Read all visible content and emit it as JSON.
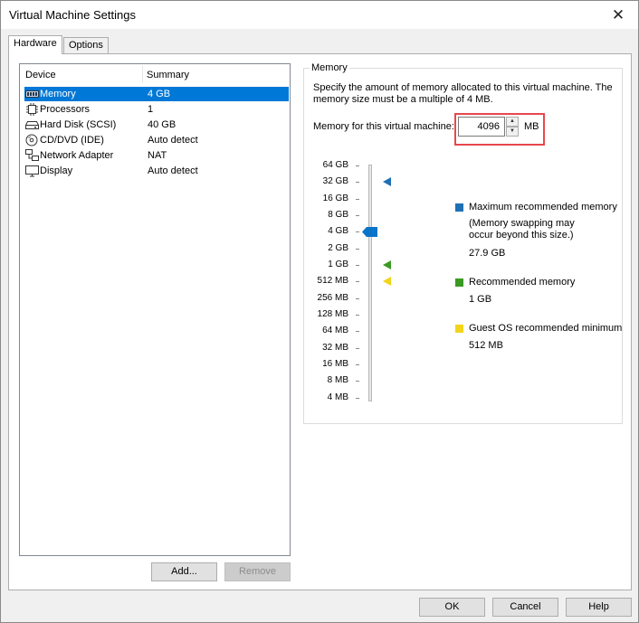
{
  "window": {
    "title": "Virtual Machine Settings",
    "close_glyph": "✕"
  },
  "tabs": [
    {
      "label": "Hardware",
      "active": true
    },
    {
      "label": "Options",
      "active": false
    }
  ],
  "device_list": {
    "columns": [
      "Device",
      "Summary"
    ],
    "rows": [
      {
        "device": "Memory",
        "summary": "4 GB",
        "icon": "memory-icon",
        "selected": true
      },
      {
        "device": "Processors",
        "summary": "1",
        "icon": "processor-icon",
        "selected": false
      },
      {
        "device": "Hard Disk (SCSI)",
        "summary": "40 GB",
        "icon": "hard-disk-icon",
        "selected": false
      },
      {
        "device": "CD/DVD (IDE)",
        "summary": "Auto detect",
        "icon": "cd-dvd-icon",
        "selected": false
      },
      {
        "device": "Network Adapter",
        "summary": "NAT",
        "icon": "network-adapter-icon",
        "selected": false
      },
      {
        "device": "Display",
        "summary": "Auto detect",
        "icon": "display-icon",
        "selected": false
      }
    ]
  },
  "list_buttons": {
    "add": "Add...",
    "remove": "Remove"
  },
  "memory": {
    "group_label": "Memory",
    "description": "Specify the amount of memory allocated to this virtual machine. The memory size must be a multiple of 4 MB.",
    "field_label": "Memory for this virtual machine:",
    "value": "4096",
    "unit": "MB",
    "scale_labels": [
      "64 GB",
      "32 GB",
      "16 GB",
      "8 GB",
      "4 GB",
      "2 GB",
      "1 GB",
      "512 MB",
      "256 MB",
      "128 MB",
      "64 MB",
      "32 MB",
      "16 MB",
      "8 MB",
      "4 MB"
    ],
    "slider_value": "4 GB",
    "legend": [
      {
        "label": "Maximum recommended memory",
        "note": "(Memory swapping may occur beyond this size.)",
        "value": "27.9 GB",
        "color": "#1f6fb5",
        "marker_at": "32 GB"
      },
      {
        "label": "Recommended memory",
        "note": "",
        "value": "1 GB",
        "color": "#3a9a23",
        "marker_at": "1 GB"
      },
      {
        "label": "Guest OS recommended minimum",
        "note": "",
        "value": "512 MB",
        "color": "#f2d51a",
        "marker_at": "512 MB"
      }
    ]
  },
  "footer_buttons": {
    "ok": "OK",
    "cancel": "Cancel",
    "help": "Help"
  },
  "colors": {
    "selection": "#0078d7",
    "highlight_box": "#e8474c",
    "slider_thumb": "#0a74c9"
  }
}
